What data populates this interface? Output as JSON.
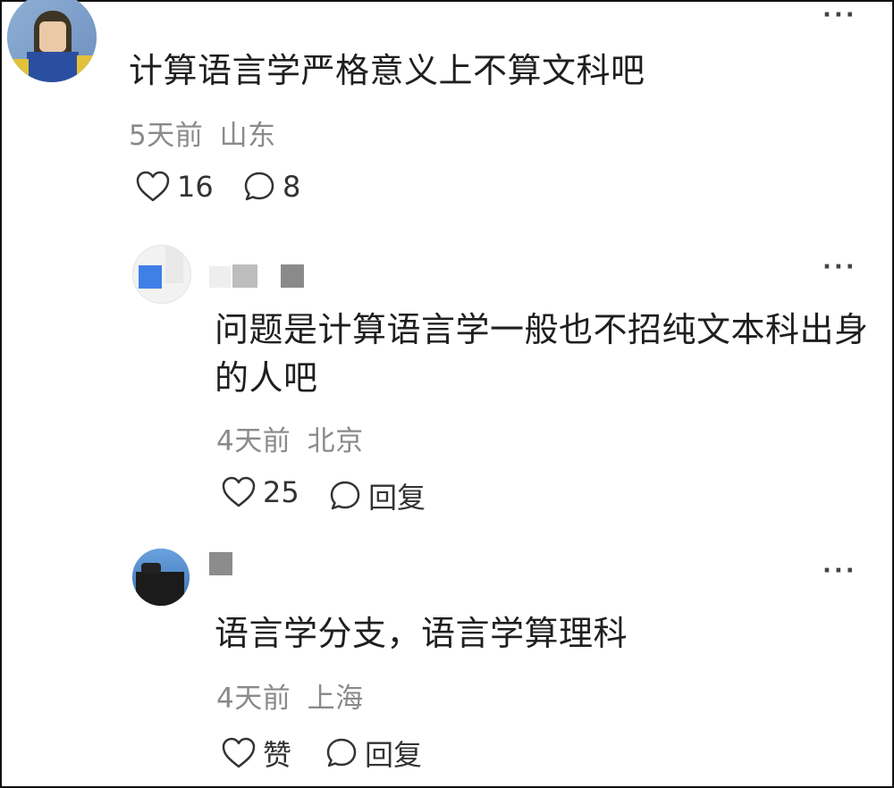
{
  "comments": [
    {
      "text": "计算语言学严格意义上不算文科吧",
      "time": "5天前",
      "location": "山东",
      "likes": "16",
      "comment_count": "8"
    },
    {
      "text_line1": "问题是计算语言学一般也不招纯文本科出身",
      "text_line2": "的人吧",
      "time": "4天前",
      "location": "北京",
      "likes": "25",
      "reply_label": "回复"
    },
    {
      "text": "语言学分支，语言学算理科",
      "time": "4天前",
      "location": "上海",
      "like_label": "赞",
      "reply_label": "回复"
    }
  ],
  "more_glyph": "···",
  "icons": {
    "like": "heart-outline-icon",
    "comment": "speech-bubble-icon",
    "more": "more-dots-icon"
  }
}
